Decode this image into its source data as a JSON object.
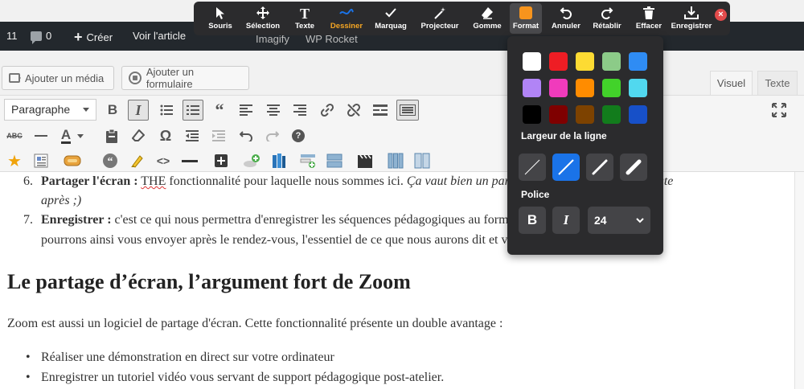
{
  "adminbar": {
    "updates": "11",
    "comments": "0",
    "new_label": "Créer",
    "view_label": "Voir l'article",
    "imagify": "Imagify",
    "wprocket": "WP Rocket"
  },
  "media": {
    "add_media": "Ajouter un média",
    "add_form": "Ajouter un formulaire"
  },
  "tabs": {
    "visual": "Visuel",
    "text": "Texte"
  },
  "toolbar": {
    "format": "Paragraphe",
    "bold": "B",
    "italic": "I",
    "abc": "ABC",
    "omega": "Ω",
    "help": "?"
  },
  "content": {
    "item6_num": "6.",
    "item6_bold": "Partager l'écran :",
    "item6_the": "THE",
    "item6_text": " fonctionnalité pour laquelle nous sommes ici. ",
    "item6_italic": "Ça vaut bien un paragraphe, donc on en parle juste",
    "item6_italic2": "après ;)",
    "item7_num": "7.",
    "item7_bold": "Enregistrer :",
    "item7_text": " c'est ce qui nous permettra d'enregistrer les séquences pédagogiques au format portable. Nous",
    "item7_text2": "pourrons ainsi vous envoyer après le rendez-vous, l'essentiel de ce que nous aurons dit et vu ensemble.",
    "heading": "Le partage d’écran, l’argument fort de Zoom",
    "paragraph": "Zoom est aussi un logiciel de partage d'écran. Cette fonctionnalité présente un double avantage :",
    "bullets": [
      "Réaliser une démonstration en direct sur votre ordinateur",
      "Enregistrer un tutoriel vidéo vous servant de support pédagogique post-atelier."
    ]
  },
  "zoom_toolbar": {
    "items": [
      {
        "label": "Souris",
        "icon": "cursor-icon"
      },
      {
        "label": "Sélection",
        "icon": "move-icon"
      },
      {
        "label": "Texte",
        "icon": "text-icon"
      },
      {
        "label": "Dessiner",
        "icon": "draw-icon"
      },
      {
        "label": "Marquag",
        "icon": "check-icon"
      },
      {
        "label": "Projecteur",
        "icon": "spotlight-icon"
      },
      {
        "label": "Gomme",
        "icon": "eraser-icon"
      },
      {
        "label": "Format",
        "icon": "format-icon"
      },
      {
        "label": "Annuler",
        "icon": "undo-icon"
      },
      {
        "label": "Rétablir",
        "icon": "redo-icon"
      },
      {
        "label": "Effacer",
        "icon": "trash-icon"
      },
      {
        "label": "Enregistrer",
        "icon": "save-icon"
      }
    ],
    "active_color": "#f7941d",
    "accent": "#f5a623"
  },
  "format_popup": {
    "colors": [
      "#ffffff",
      "#ee1d24",
      "#fddb33",
      "#8ccb88",
      "#2f8cf4",
      "#b184f6",
      "#f03bbc",
      "#ff8c00",
      "#42d22a",
      "#51d8ef",
      "#000000",
      "#7f0000",
      "#7d4200",
      "#127c1c",
      "#1750c8"
    ],
    "line_width_label": "Largeur de la ligne",
    "font_label": "Police",
    "bold": "B",
    "italic": "I",
    "font_size": "24",
    "selected_width": 2
  }
}
